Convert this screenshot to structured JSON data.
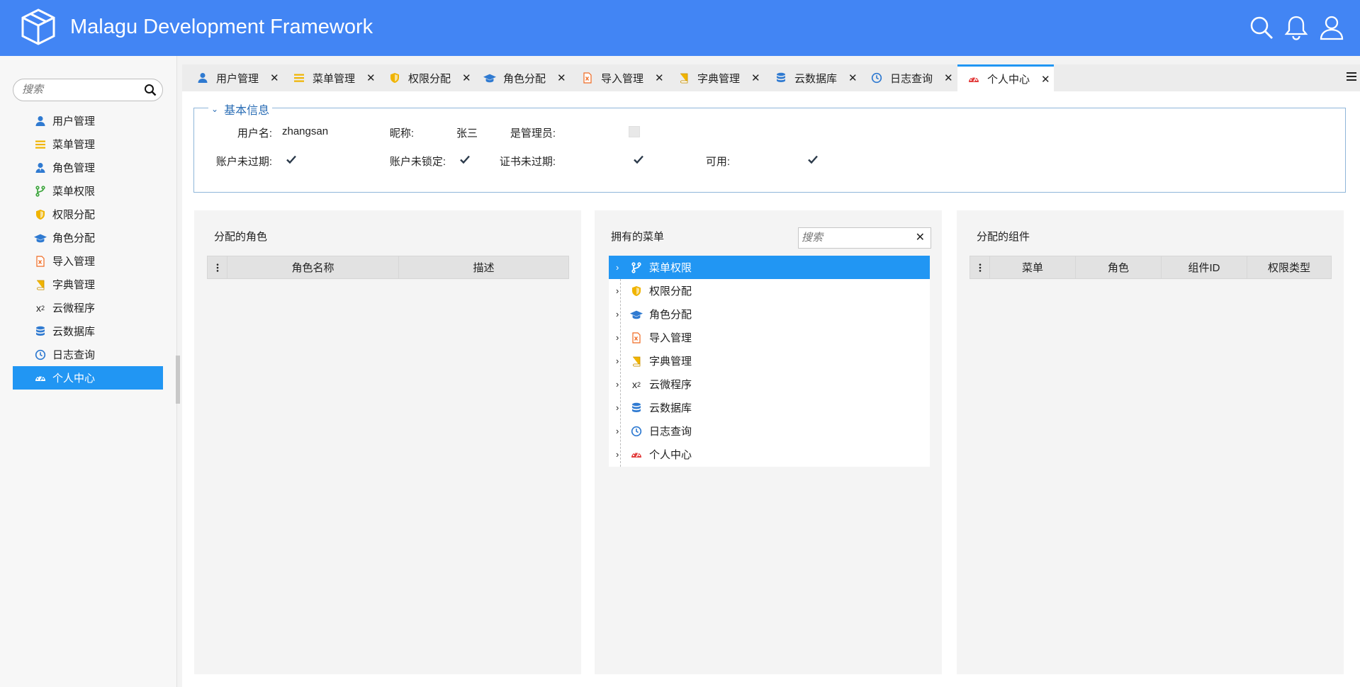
{
  "header": {
    "title": "Malagu Development Framework",
    "icons": [
      "logo-cube-icon",
      "search-icon",
      "bell-icon",
      "user-icon"
    ]
  },
  "sidebar": {
    "search_placeholder": "搜索",
    "items": [
      {
        "label": "用户管理",
        "icon": "user-icon"
      },
      {
        "label": "菜单管理",
        "icon": "bars-icon"
      },
      {
        "label": "角色管理",
        "icon": "user-tie-icon"
      },
      {
        "label": "菜单权限",
        "icon": "code-branch-icon"
      },
      {
        "label": "权限分配",
        "icon": "shield-icon"
      },
      {
        "label": "角色分配",
        "icon": "graduation-cap-icon"
      },
      {
        "label": "导入管理",
        "icon": "file-excel-icon"
      },
      {
        "label": "字典管理",
        "icon": "book-icon"
      },
      {
        "label": "云微程序",
        "icon": "superscript-icon"
      },
      {
        "label": "云数据库",
        "icon": "database-icon"
      },
      {
        "label": "日志查询",
        "icon": "clock-icon"
      },
      {
        "label": "个人中心",
        "icon": "tachometer-icon",
        "active": true
      }
    ]
  },
  "tabs": [
    {
      "label": "用户管理",
      "icon": "user-icon"
    },
    {
      "label": "菜单管理",
      "icon": "bars-icon"
    },
    {
      "label": "权限分配",
      "icon": "shield-icon"
    },
    {
      "label": "角色分配",
      "icon": "graduation-cap-icon"
    },
    {
      "label": "导入管理",
      "icon": "file-excel-icon"
    },
    {
      "label": "字典管理",
      "icon": "book-icon"
    },
    {
      "label": "云数据库",
      "icon": "database-icon"
    },
    {
      "label": "日志查询",
      "icon": "clock-icon"
    },
    {
      "label": "个人中心",
      "icon": "tachometer-icon",
      "active": true
    }
  ],
  "basic_info": {
    "legend": "基本信息",
    "username_label": "用户名:",
    "username_value": "zhangsan",
    "nickname_label": "昵称:",
    "nickname_value": "张三",
    "is_admin_label": "是管理员:",
    "is_admin": false,
    "account_not_expired_label": "账户未过期:",
    "account_not_expired": true,
    "account_not_locked_label": "账户未锁定:",
    "account_not_locked": true,
    "credentials_not_expired_label": "证书未过期:",
    "credentials_not_expired": true,
    "enabled_label": "可用:",
    "enabled": true
  },
  "roles_panel": {
    "title": "分配的角色",
    "columns": [
      "角色名称",
      "描述"
    ]
  },
  "menus_panel": {
    "title": "拥有的菜单",
    "search_placeholder": "搜索",
    "nodes": [
      {
        "label": "菜单权限",
        "icon": "code-branch-icon",
        "selected": true
      },
      {
        "label": "权限分配",
        "icon": "shield-icon"
      },
      {
        "label": "角色分配",
        "icon": "graduation-cap-icon"
      },
      {
        "label": "导入管理",
        "icon": "file-excel-icon"
      },
      {
        "label": "字典管理",
        "icon": "book-icon"
      },
      {
        "label": "云微程序",
        "icon": "superscript-icon"
      },
      {
        "label": "云数据库",
        "icon": "database-icon"
      },
      {
        "label": "日志查询",
        "icon": "clock-icon"
      },
      {
        "label": "个人中心",
        "icon": "tachometer-icon"
      }
    ]
  },
  "components_panel": {
    "title": "分配的组件",
    "columns": [
      "菜单",
      "角色",
      "组件ID",
      "权限类型"
    ]
  },
  "colors": {
    "header": "#4285f4",
    "accent": "#2196f3",
    "legend": "#2a6db5"
  }
}
